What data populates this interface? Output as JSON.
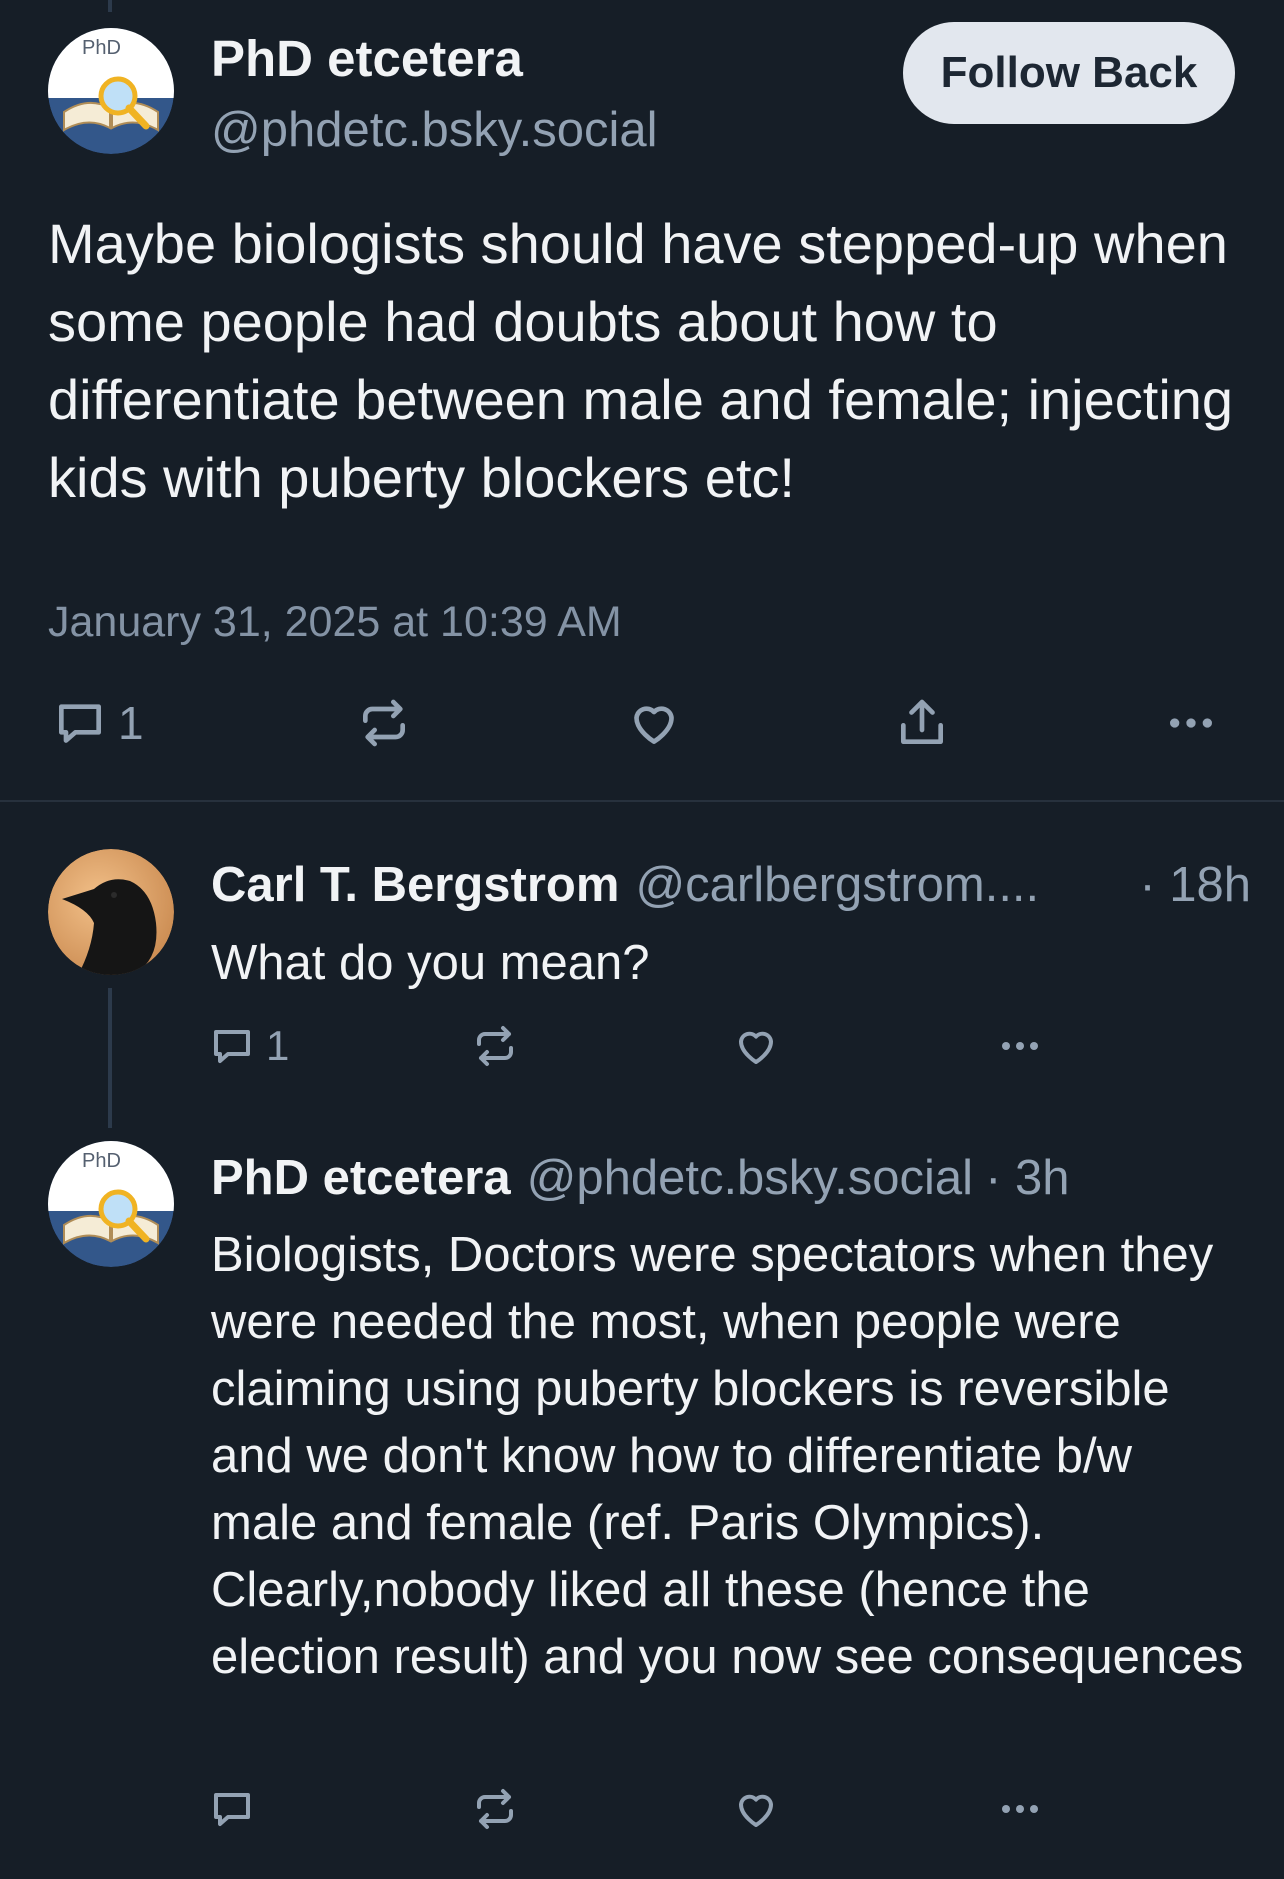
{
  "main_post": {
    "author_name": "PhD etcetera",
    "author_handle": "@phdetc.bsky.social",
    "avatar_text": "PhD",
    "follow_button": "Follow Back",
    "text": "Maybe biologists should have stepped-up when some people had doubts about how to differentiate between male and female; injecting kids with puberty blockers etc!",
    "timestamp": "January 31, 2025 at 10:39 AM",
    "reply_count": "1",
    "icons": [
      "comment-icon",
      "repost-icon",
      "like-icon",
      "share-icon",
      "more-icon"
    ]
  },
  "replies": [
    {
      "author_name": "Carl T. Bergstrom",
      "author_handle": "@carlbergstrom....",
      "time": "· 18h",
      "text": "What do you mean?",
      "reply_count": "1"
    },
    {
      "author_name": "PhD etcetera",
      "author_handle": "@phdetc.bsky.social",
      "time": "· 3h",
      "avatar_text": "PhD",
      "text": "Biologists, Doctors were spectators when they were needed the most, when people were claiming using puberty blockers is reversible and we don't know how to differentiate b/w male and female (ref. Paris Olympics). Clearly,nobody liked all these (hence the election result) and you now see consequences",
      "reply_count": ""
    }
  ],
  "colors": {
    "background": "#161e27",
    "text_primary": "#f1f3f5",
    "text_secondary": "#93a2b3",
    "button_bg": "#e2e7ee",
    "divider": "#27313d"
  }
}
